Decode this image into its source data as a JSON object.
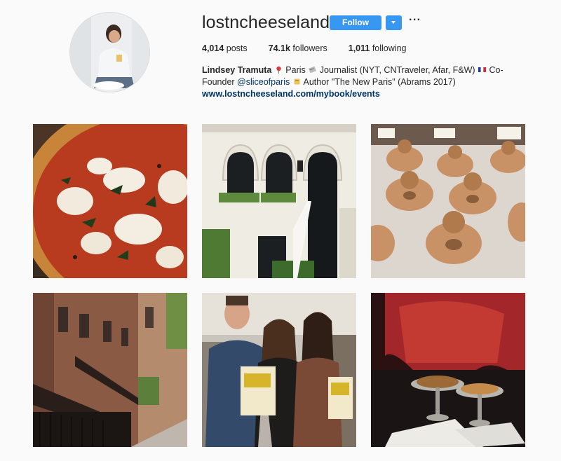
{
  "profile": {
    "username": "lostncheeseland",
    "follow_label": "Follow",
    "more_label": "···",
    "stats": [
      {
        "count": "4,014",
        "label": "posts"
      },
      {
        "count": "74.1k",
        "label": "followers"
      },
      {
        "count": "1,011",
        "label": "following"
      }
    ],
    "bio": {
      "name": "Lindsey Tramuta",
      "part1": " Paris ",
      "part2": " Journalist (NYT, CNTraveler, Afar, F&W) ",
      "part3": " Co-Founder ",
      "mention": "@sliceofparis",
      "part4": " Author \"The New Paris\" (Abrams 2017)",
      "link": "www.lostncheeseland.com/mybook/events"
    }
  },
  "posts": [
    {
      "subject": "pizza"
    },
    {
      "subject": "townhouse"
    },
    {
      "subject": "donuts"
    },
    {
      "subject": "brownstones"
    },
    {
      "subject": "group-photo"
    },
    {
      "subject": "snacks"
    }
  ],
  "colors": {
    "accent": "#3897f0",
    "link": "#003569",
    "background": "#fafafa"
  }
}
